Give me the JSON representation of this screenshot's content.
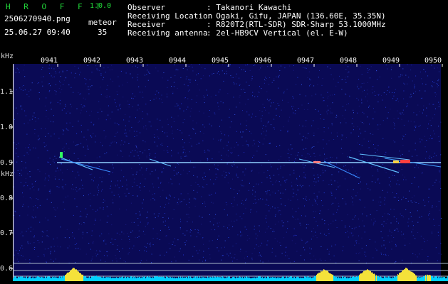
{
  "header": {
    "brand": "H R O F F T",
    "version": "1.0.0",
    "filename": "2506270940.png",
    "datetime": "25.06.27 09:40",
    "meteor_label": "meteor",
    "meteor_count": "35",
    "fields": [
      {
        "label": "Observer",
        "value": ": Takanori Kawachi"
      },
      {
        "label": "Receiving Location",
        "value": ": Ogaki, Gifu, JAPAN (136.60E, 35.35N)"
      },
      {
        "label": "Receiver",
        "value": ": R820T2(RTL-SDR) SDR-Sharp 53.1000MHz"
      },
      {
        "label": "Receiving antenna",
        "value": ": 2el-HB9CV Vertical (el. E-W)"
      }
    ]
  },
  "spectrogram": {
    "y_unit": "kHz",
    "y_unit_bottom": "kHz",
    "y_ticks": [
      "1.1",
      "1.0",
      "0.9",
      "0.8",
      "0.7",
      "0.6"
    ],
    "x_ticks": [
      "0941",
      "0942",
      "0943",
      "0944",
      "0945",
      "0946",
      "0947",
      "0948",
      "0949",
      "0950"
    ],
    "colors": {
      "background": "#0a0a55",
      "carrier": "#8fd0ff",
      "axis": "#ffffff",
      "label": "#f0e030",
      "bars": "#00d0ff"
    }
  }
}
